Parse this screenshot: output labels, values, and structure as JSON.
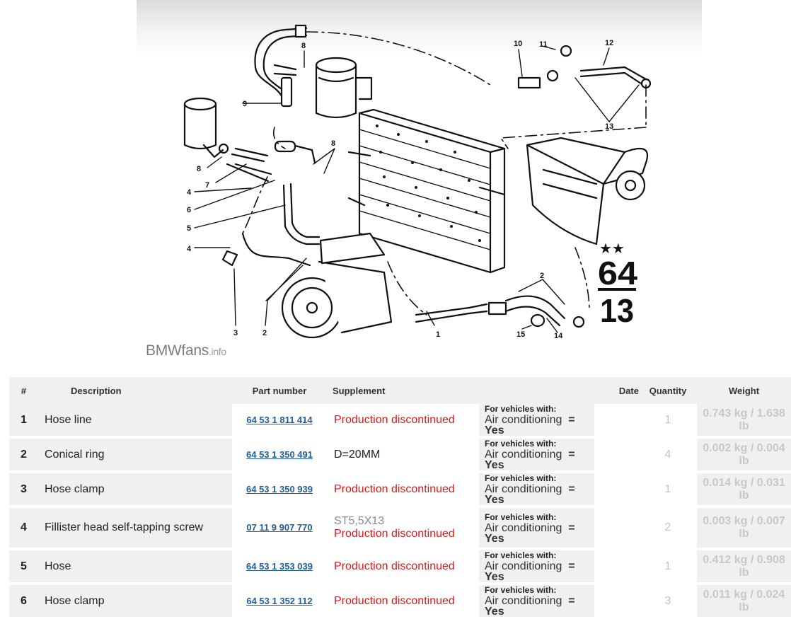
{
  "diagram": {
    "group_number_top": "64",
    "group_number_bottom": "13",
    "callouts": [
      "1",
      "2",
      "3",
      "4",
      "4",
      "5",
      "6",
      "7",
      "8",
      "8",
      "9",
      "10",
      "11",
      "12",
      "13",
      "14",
      "15",
      "2",
      "8"
    ],
    "watermark_main": "BMWfans",
    "watermark_suffix": ".info"
  },
  "table": {
    "headers": {
      "num": "#",
      "description": "Description",
      "part_number": "Part number",
      "supplement": "Supplement",
      "date": "Date",
      "quantity": "Quantity",
      "weight": "Weight"
    },
    "vehicle_header": "For vehicles with:",
    "vehicle_feature": "Air conditioning",
    "vehicle_value": "= Yes",
    "rows": [
      {
        "num": "1",
        "description": "Hose line",
        "part_number": "64 53 1 811 414",
        "supplement_top": "",
        "supplement": "Production discontinued",
        "supplement_style": "disc",
        "quantity": "1",
        "weight": "0.743 kg / 1.638 lb"
      },
      {
        "num": "2",
        "description": "Conical ring",
        "part_number": "64 53 1 350 491",
        "supplement_top": "",
        "supplement": "D=20MM",
        "supplement_style": "plain",
        "quantity": "4",
        "weight": "0.002 kg / 0.004 lb"
      },
      {
        "num": "3",
        "description": "Hose clamp",
        "part_number": "64 53 1 350 939",
        "supplement_top": "",
        "supplement": "Production discontinued",
        "supplement_style": "disc",
        "quantity": "1",
        "weight": "0.014 kg / 0.031 lb"
      },
      {
        "num": "4",
        "description": "Fillister head self-tapping screw",
        "part_number": "07 11 9 907 770",
        "supplement_top": "ST5,5X13",
        "supplement": "Production discontinued",
        "supplement_style": "disc",
        "quantity": "2",
        "weight": "0.003 kg / 0.007 lb"
      },
      {
        "num": "5",
        "description": "Hose",
        "part_number": "64 53 1 353 039",
        "supplement_top": "",
        "supplement": "Production discontinued",
        "supplement_style": "disc",
        "quantity": "1",
        "weight": "0.412 kg / 0.908 lb"
      },
      {
        "num": "6",
        "description": "Hose clamp",
        "part_number": "64 53 1 352 112",
        "supplement_top": "",
        "supplement": "Production discontinued",
        "supplement_style": "disc",
        "quantity": "3",
        "weight": "0.011 kg / 0.024 lb"
      }
    ]
  }
}
